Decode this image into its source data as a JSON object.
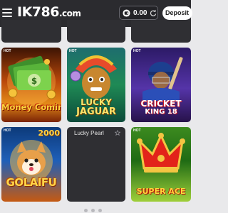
{
  "header": {
    "logo_text": "IK786",
    "logo_tld": ".com",
    "balance": "0.00",
    "deposit_label": "Deposit"
  },
  "badges": {
    "hot": "HOT"
  },
  "games": [
    {
      "title": "Money Coming"
    },
    {
      "title_line1": "LUCKY",
      "title_line2": "JAGUAR"
    },
    {
      "title_line1": "CRICKET",
      "title_line2": "KING 18"
    },
    {
      "title": "GOLAIFU",
      "number": "2000"
    },
    {
      "title": "Lucky Pearl"
    },
    {
      "title": "SUPER ACE"
    }
  ],
  "icons": [
    "menu-icon",
    "wallet-icon",
    "refresh-icon",
    "star-icon"
  ],
  "colors": {
    "header_bg": "#2b2b2f",
    "tile_bg": "#2f2f33",
    "page_bg": "#e9e9eb"
  }
}
